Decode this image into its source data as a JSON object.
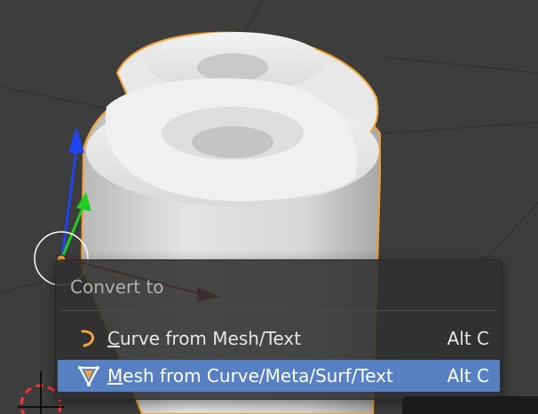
{
  "menu": {
    "title": "Convert to",
    "items": [
      {
        "mnemonic": "C",
        "rest": "urve from Mesh/Text",
        "shortcut": "Alt C",
        "icon": "curve-icon",
        "highlighted": false
      },
      {
        "mnemonic": "M",
        "rest": "esh from Curve/Meta/Surf/Text",
        "shortcut": "Alt C",
        "icon": "mesh-icon",
        "highlighted": true
      }
    ]
  },
  "colors": {
    "viewport_bg": "#3d3d3d",
    "menu_bg": "#303030",
    "highlight": "#5680c2",
    "selection_outline": "#f0a030",
    "axis_z": "#2244ee",
    "axis_y": "#22cc22",
    "axis_x": "#cc2222",
    "icon_orange": "#f5a040"
  }
}
